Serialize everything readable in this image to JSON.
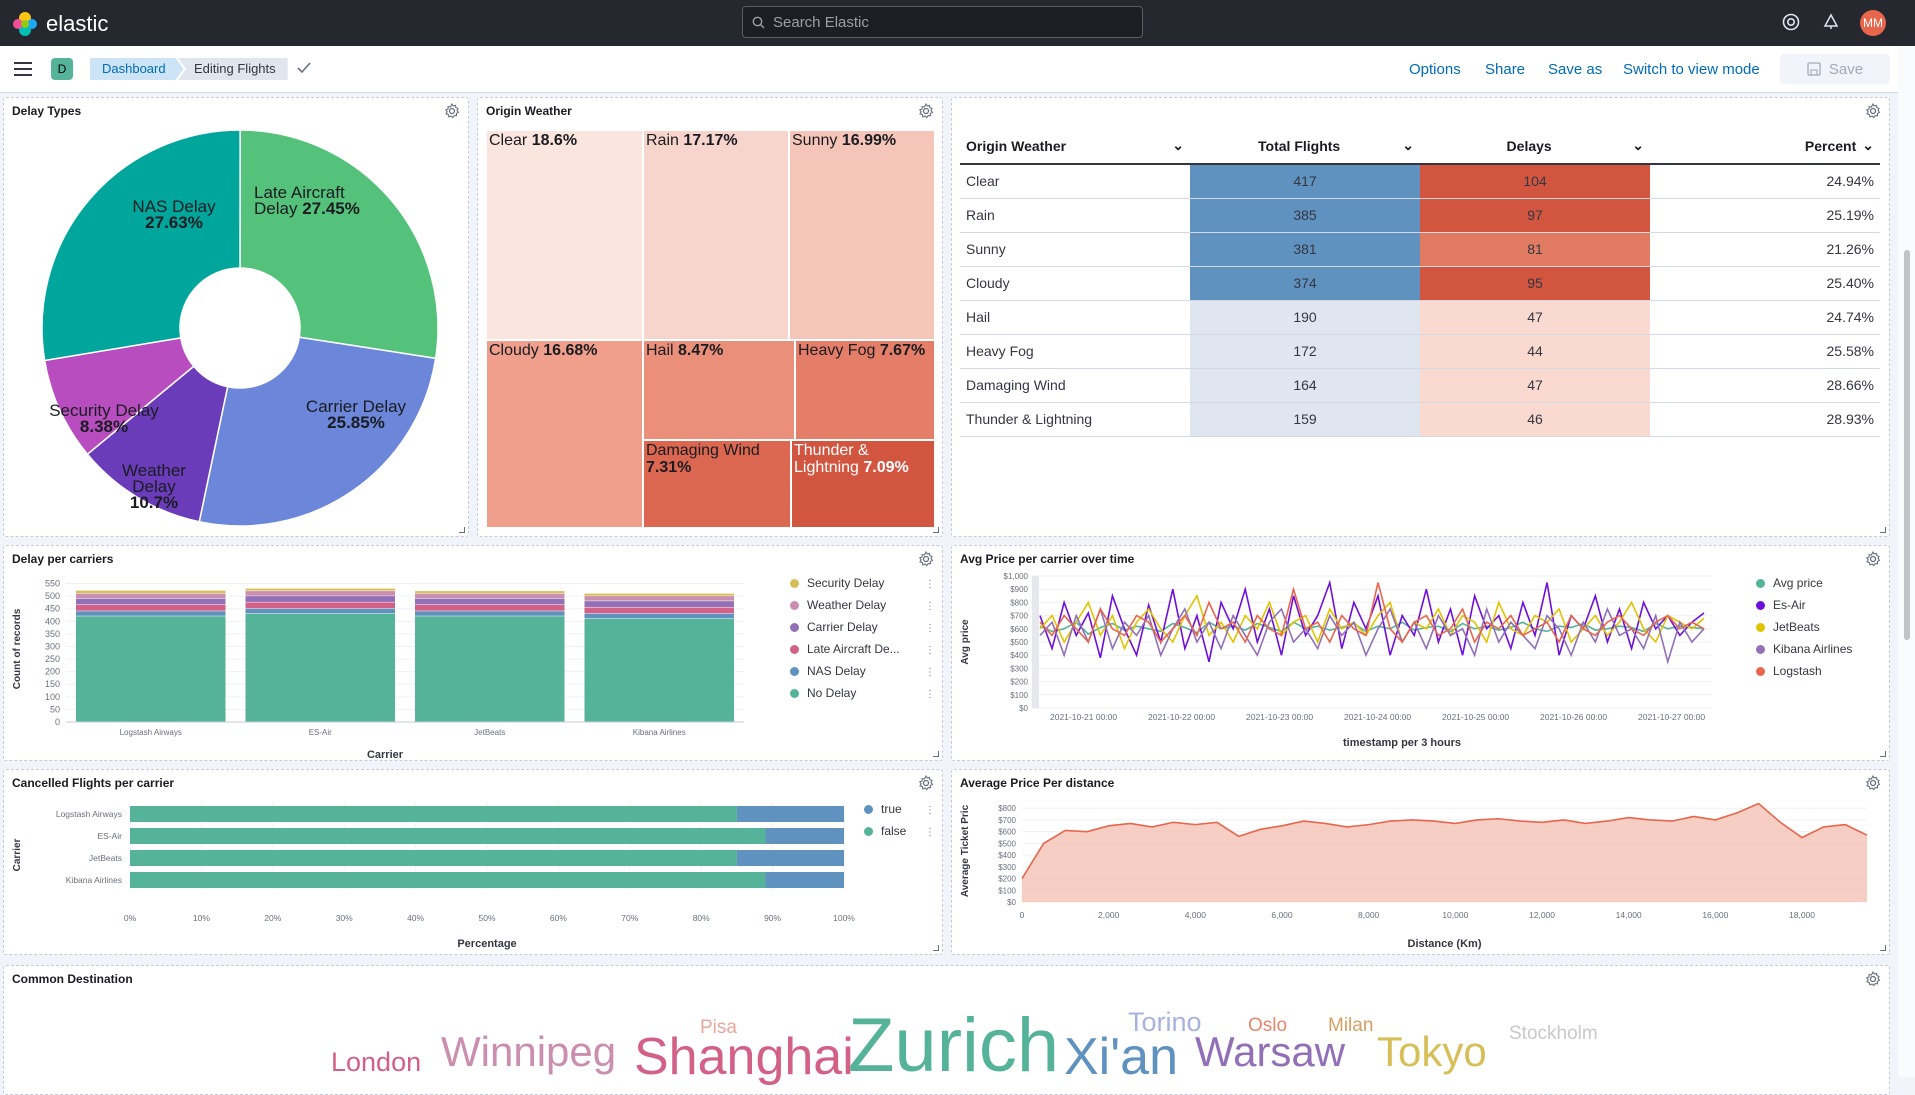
{
  "app": {
    "logo_text": "elastic",
    "search_placeholder": "Search Elastic",
    "avatar": "MM",
    "space_letter": "D"
  },
  "breadcrumbs": [
    "Dashboard",
    "Editing Flights"
  ],
  "nav": {
    "options": "Options",
    "share": "Share",
    "save_as": "Save as",
    "switch": "Switch to view mode",
    "save": "Save"
  },
  "colors": {
    "accent": "#006bb8",
    "green": "#54b399",
    "blue": "#6092c0",
    "pink": "#d36086",
    "purple": "#9170b8",
    "red": "#e7664c",
    "yellow": "#d6bf57"
  },
  "panels": {
    "delay_types": {
      "title": "Delay Types"
    },
    "origin_weather": {
      "title": "Origin Weather"
    },
    "delay_carriers": {
      "title": "Delay per carriers"
    },
    "avg_price": {
      "title": "Avg Price per carrier over time"
    },
    "cancelled": {
      "title": "Cancelled Flights per carrier"
    },
    "price_distance": {
      "title": "Average Price Per distance"
    },
    "common_dest": {
      "title": "Common Destination"
    }
  },
  "pie": {
    "slices": [
      {
        "label": "Late Aircraft Delay",
        "value": "27.45%",
        "pct": 27.45,
        "color": "#54c27a"
      },
      {
        "label": "Carrier Delay",
        "value": "25.85%",
        "pct": 25.85,
        "color": "#6c86d9"
      },
      {
        "label": "Weather Delay",
        "value": "10.7%",
        "pct": 10.7,
        "color": "#6a3cba"
      },
      {
        "label": "Security Delay",
        "value": "8.38%",
        "pct": 8.38,
        "color": "#b84dbf"
      },
      {
        "label": "NAS Delay",
        "value": "27.63%",
        "pct": 27.63,
        "color": "#00a69b"
      }
    ]
  },
  "treemap": {
    "cells": [
      {
        "label": "Clear",
        "value": "18.6%"
      },
      {
        "label": "Rain",
        "value": "17.17%"
      },
      {
        "label": "Sunny",
        "value": "16.99%"
      },
      {
        "label": "Cloudy",
        "value": "16.68%"
      },
      {
        "label": "Hail",
        "value": "8.47%"
      },
      {
        "label": "Heavy Fog",
        "value": "7.67%"
      },
      {
        "label": "Damaging Wind",
        "value": "7.31%"
      },
      {
        "label": "Thunder & Lightning",
        "value": "7.09%"
      }
    ]
  },
  "weather_table": {
    "headers": [
      "Origin Weather",
      "Total Flights",
      "Delays",
      "Percent"
    ],
    "rows": [
      [
        "Clear",
        "417",
        "104",
        "24.94%"
      ],
      [
        "Rain",
        "385",
        "97",
        "25.19%"
      ],
      [
        "Sunny",
        "381",
        "81",
        "21.26%"
      ],
      [
        "Cloudy",
        "374",
        "95",
        "25.40%"
      ],
      [
        "Hail",
        "190",
        "47",
        "24.74%"
      ],
      [
        "Heavy Fog",
        "172",
        "44",
        "25.58%"
      ],
      [
        "Damaging Wind",
        "164",
        "47",
        "28.66%"
      ],
      [
        "Thunder & Lightning",
        "159",
        "46",
        "28.93%"
      ]
    ]
  },
  "chart_data": [
    {
      "type": "bar",
      "id": "delay_carriers",
      "categories": [
        "Logstash Airways",
        "ES-Air",
        "JetBeats",
        "Kibana Airlines"
      ],
      "xlabel": "Carrier",
      "ylabel": "Count of records",
      "yticks": [
        "0",
        "50",
        "100",
        "150",
        "200",
        "250",
        "300",
        "350",
        "400",
        "450",
        "500",
        "550"
      ],
      "ylim": [
        0,
        580
      ],
      "series": [
        {
          "name": "No Delay",
          "color": "#54b399",
          "values": [
            420,
            430,
            420,
            410
          ]
        },
        {
          "name": "NAS Delay",
          "color": "#6092c0",
          "values": [
            20,
            20,
            20,
            20
          ]
        },
        {
          "name": "Late Aircraft De...",
          "color": "#d36086",
          "values": [
            25,
            25,
            25,
            25
          ]
        },
        {
          "name": "Carrier Delay",
          "color": "#9170b8",
          "values": [
            25,
            25,
            25,
            25
          ]
        },
        {
          "name": "Weather Delay",
          "color": "#ca8eae",
          "values": [
            20,
            20,
            20,
            20
          ]
        },
        {
          "name": "Security Delay",
          "color": "#d6bf57",
          "values": [
            12,
            10,
            10,
            10
          ]
        }
      ]
    },
    {
      "type": "line",
      "id": "avg_price",
      "xlabel": "timestamp per 3 hours",
      "ylabel": "Avg price",
      "xticks": [
        "2021-10-21 00:00",
        "2021-10-22 00:00",
        "2021-10-23 00:00",
        "2021-10-24 00:00",
        "2021-10-25 00:00",
        "2021-10-26 00:00",
        "2021-10-27 00:00"
      ],
      "yticks": [
        "$0",
        "$100",
        "$200",
        "$300",
        "$400",
        "$500",
        "$600",
        "$700",
        "$800",
        "$900",
        "$1,000"
      ],
      "ylim": [
        0,
        1000
      ],
      "series": [
        {
          "name": "Avg price",
          "color": "#54b399",
          "values": [
            620,
            580,
            600,
            650,
            560,
            610,
            640,
            590,
            620,
            600,
            580,
            640,
            610,
            570,
            650,
            600,
            620,
            590,
            640,
            610,
            580,
            650,
            600,
            620,
            590,
            610,
            640,
            580,
            620,
            600,
            650,
            590,
            610,
            620,
            580,
            640,
            600,
            620,
            590,
            610,
            650,
            600,
            580,
            620,
            610,
            640,
            590,
            600,
            620,
            610,
            580,
            640,
            600,
            620,
            610,
            600
          ]
        },
        {
          "name": "Es-Air",
          "color": "#6f0fdc",
          "values": [
            700,
            450,
            800,
            550,
            720,
            380,
            850,
            600,
            400,
            780,
            500,
            900,
            450,
            700,
            350,
            800,
            600,
            900,
            500,
            750,
            400,
            850,
            550,
            700,
            950,
            450,
            800,
            600,
            850,
            400,
            700,
            550,
            900,
            500,
            750,
            400,
            850,
            600,
            700,
            450,
            800,
            550,
            950,
            400,
            700,
            600,
            850,
            500,
            750,
            450,
            800,
            600,
            700,
            550,
            650,
            720
          ]
        },
        {
          "name": "JetBeats",
          "color": "#e2c300",
          "values": [
            600,
            700,
            500,
            650,
            800,
            550,
            700,
            450,
            650,
            750,
            600,
            500,
            700,
            850,
            550,
            650,
            500,
            700,
            600,
            800,
            550,
            650,
            700,
            500,
            750,
            600,
            650,
            550,
            700,
            800,
            500,
            650,
            600,
            750,
            550,
            700,
            650,
            500,
            800,
            600,
            550,
            700,
            650,
            750,
            500,
            600,
            700,
            550,
            650,
            800,
            600,
            500,
            700,
            650,
            600,
            680
          ]
        },
        {
          "name": "Kibana Airlines",
          "color": "#9170b8",
          "values": [
            550,
            650,
            400,
            700,
            500,
            750,
            450,
            650,
            550,
            700,
            400,
            600,
            750,
            500,
            650,
            450,
            700,
            550,
            400,
            650,
            750,
            500,
            600,
            450,
            700,
            550,
            650,
            400,
            600,
            750,
            500,
            650,
            450,
            700,
            550,
            600,
            400,
            750,
            500,
            650,
            550,
            450,
            700,
            600,
            400,
            650,
            500,
            750,
            550,
            600,
            450,
            700,
            350,
            650,
            500,
            600
          ]
        },
        {
          "name": "Logstash",
          "color": "#e7664c",
          "values": [
            650,
            550,
            700,
            600,
            500,
            750,
            600,
            550,
            700,
            650,
            500,
            600,
            700,
            550,
            800,
            600,
            650,
            500,
            700,
            600,
            550,
            900,
            600,
            650,
            500,
            700,
            600,
            550,
            950,
            600,
            500,
            650,
            700,
            550,
            600,
            750,
            500,
            650,
            600,
            700,
            550,
            600,
            650,
            500,
            700,
            600,
            550,
            650,
            700,
            600,
            550,
            650,
            700,
            600,
            650,
            600
          ]
        }
      ]
    },
    {
      "type": "bar",
      "id": "cancelled",
      "orientation": "horizontal",
      "categories": [
        "Logstash Airways",
        "ES-Air",
        "JetBeats",
        "Kibana Airlines"
      ],
      "xlabel": "Percentage",
      "ylabel": "Carrier",
      "xticks": [
        "0%",
        "10%",
        "20%",
        "30%",
        "40%",
        "50%",
        "60%",
        "70%",
        "80%",
        "90%",
        "100%"
      ],
      "xlim": [
        0,
        100
      ],
      "series": [
        {
          "name": "false",
          "color": "#54b399",
          "values": [
            85,
            89,
            85,
            89
          ]
        },
        {
          "name": "true",
          "color": "#6092c0",
          "values": [
            15,
            11,
            15,
            11
          ]
        }
      ]
    },
    {
      "type": "area",
      "id": "price_distance",
      "xlabel": "Distance (Km)",
      "ylabel": "Average Ticket Pric",
      "xticks": [
        "0",
        "2,000",
        "4,000",
        "6,000",
        "8,000",
        "10,000",
        "12,000",
        "14,000",
        "16,000",
        "18,000"
      ],
      "yticks": [
        "$0",
        "$100",
        "$200",
        "$300",
        "$400",
        "$500",
        "$600",
        "$700",
        "$800"
      ],
      "ylim": [
        0,
        870
      ],
      "x": [
        0,
        500,
        1000,
        1500,
        2000,
        2500,
        3000,
        3500,
        4000,
        4500,
        5000,
        5500,
        6000,
        6500,
        7000,
        7500,
        8000,
        8500,
        9000,
        9500,
        10000,
        10500,
        11000,
        11500,
        12000,
        12500,
        13000,
        13500,
        14000,
        14500,
        15000,
        15500,
        16000,
        16500,
        17000,
        17500,
        18000,
        18500,
        19000,
        19500
      ],
      "values": [
        200,
        500,
        610,
        600,
        650,
        670,
        640,
        680,
        660,
        680,
        560,
        620,
        650,
        690,
        670,
        640,
        660,
        690,
        700,
        690,
        670,
        700,
        710,
        690,
        680,
        700,
        670,
        690,
        720,
        700,
        690,
        730,
        700,
        760,
        840,
        680,
        550,
        640,
        660,
        570
      ]
    }
  ],
  "legends": {
    "cancelled": [
      "true",
      "false"
    ],
    "delay": [
      "Security Delay",
      "Weather Delay",
      "Carrier Delay",
      "Late Aircraft De...",
      "NAS Delay",
      "No Delay"
    ],
    "avg": [
      "Avg price",
      "Es-Air",
      "JetBeats",
      "Kibana Airlines",
      "Logstash"
    ]
  },
  "wordcloud": [
    {
      "word": "London",
      "color": "#d36086",
      "size": 27
    },
    {
      "word": "Winnipeg",
      "color": "#ca8eae",
      "size": 42
    },
    {
      "word": "Pisa",
      "color": "#e7a79d",
      "size": 19
    },
    {
      "word": "Shanghai",
      "color": "#d36086",
      "size": 52
    },
    {
      "word": "Zurich",
      "color": "#54b399",
      "size": 76
    },
    {
      "word": "Torino",
      "color": "#a7b3dd",
      "size": 27
    },
    {
      "word": "Xi'an",
      "color": "#6092c0",
      "size": 52
    },
    {
      "word": "Oslo",
      "color": "#e7866c",
      "size": 19
    },
    {
      "word": "Warsaw",
      "color": "#9170b8",
      "size": 42
    },
    {
      "word": "Milan",
      "color": "#d6a062",
      "size": 19
    },
    {
      "word": "Tokyo",
      "color": "#d6bf57",
      "size": 42
    },
    {
      "word": "Stockholm",
      "color": "#c9c9c9",
      "size": 19
    }
  ]
}
